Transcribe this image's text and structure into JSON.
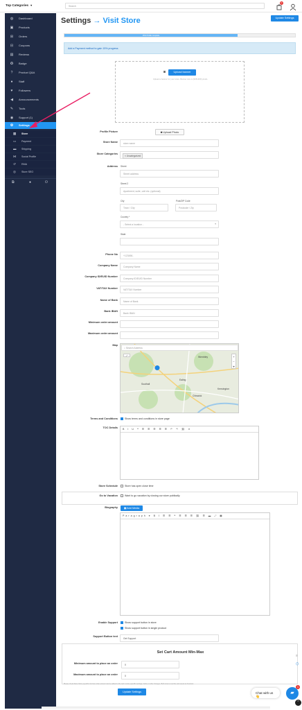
{
  "topbar": {
    "category_label": "Top Categories",
    "search_placeholder": "Search",
    "notification_count": "0"
  },
  "sidebar": {
    "items": [
      {
        "label": "Dashboard",
        "icon": "dashboard-icon"
      },
      {
        "label": "Products",
        "icon": "products-icon"
      },
      {
        "label": "Orders",
        "icon": "orders-icon"
      },
      {
        "label": "Coupons",
        "icon": "coupons-icon"
      },
      {
        "label": "Reviews",
        "icon": "reviews-icon"
      },
      {
        "label": "Badge",
        "icon": "badge-icon"
      },
      {
        "label": "Product Q&A",
        "icon": "question-icon"
      },
      {
        "label": "Staff",
        "icon": "staff-icon"
      },
      {
        "label": "Followers",
        "icon": "heart-icon"
      },
      {
        "label": "Announcements",
        "icon": "megaphone-icon"
      },
      {
        "label": "Tools",
        "icon": "wrench-icon"
      },
      {
        "label": "Support (1)",
        "icon": "support-icon"
      },
      {
        "label": "Settings",
        "icon": "gear-icon"
      }
    ],
    "sub_items": [
      {
        "label": "Store",
        "icon": "store-icon"
      },
      {
        "label": "Payment",
        "icon": "card-icon"
      },
      {
        "label": "Shipping",
        "icon": "truck-icon"
      },
      {
        "label": "Social Profile",
        "icon": "share-icon"
      },
      {
        "label": "RMA",
        "icon": "undo-icon"
      },
      {
        "label": "Store SEO",
        "icon": "globe-icon"
      }
    ]
  },
  "page": {
    "title": "Settings",
    "arrow": "→",
    "visit_store": "Visit Store",
    "update_settings": "Update Settings",
    "progress_text": "15% Profile complete",
    "progress_value": 0.75,
    "alert": "Add a Payment method to gain 15% progress",
    "upload_banner": "Upload banner",
    "banner_hint": "Upload a banner for your store. Banner size is (625x300) pixels."
  },
  "form": {
    "profile_picture": "Profile Picture",
    "upload_photo": "Upload Photo",
    "store_name": "Store Name",
    "store_name_ph": "store name",
    "store_categories": "Store Categories",
    "category_tag": "× Uncategorized",
    "address": "Address",
    "street": "Street",
    "street_ph": "Street address",
    "street2": "Street 2",
    "street2_ph": "Apartment, suite, unit etc. (optional)",
    "city": "City",
    "city_ph": "Town / City",
    "zip": "Post/ZIP Code",
    "zip_ph": "Postcode / Zip",
    "country": "Country *",
    "country_ph": "- Select a location -",
    "state": "State",
    "phone": "Phone No",
    "phone_ph": "+123456..",
    "company_name": "Company Name",
    "company_name_ph": "Company Name",
    "company_id": "Company ID/EUID Number",
    "company_id_ph": "Company ID/EUID Number",
    "vat": "VAT/TAX Number",
    "vat_ph": "VAT/TAX Number",
    "bank_name": "Name of Bank",
    "bank_name_ph": "Name of Bank",
    "iban": "Bank IBAN",
    "iban_ph": "Bank IBAN",
    "min_order": "Minimum order amount",
    "max_order": "Maximum order amount",
    "map": "Map",
    "map_search_ph": "Search Address",
    "map_labels": [
      "Wembley",
      "Ealing",
      "Southall",
      "Chiswick",
      "Kensington"
    ],
    "terms": "Terms and Conditions",
    "terms_check": "Show terms and conditions in store page",
    "toc": "TOC Details",
    "schedule": "Store Schedule",
    "schedule_check": "Store has open close time",
    "vacation": "Go to Vacation",
    "vacation_check": "Want to go vacation by closing our store publically",
    "biography": "Biography",
    "add_media": "Add Media",
    "paragraph": "Paragraph",
    "enable_support": "Enable Support",
    "support_check1": "Show support button in store",
    "support_check2": "Show support button in single product",
    "support_text": "Support Button text",
    "support_text_val": "Get Support",
    "cart_title": "Set Cart Amount Min-Max",
    "cart_min": "Minimum amount to place an order",
    "cart_min_val": "0",
    "cart_max": "Maximum amount to place an order",
    "cart_max_val": "0",
    "fine_print": "Please check that a Store-specific min/max order amount can be added to the cart in store-specific settings, before or after changes. Both store's override and saved at checkout.",
    "update_settings_bottom": "Update Settings",
    "chat": "Chat with us 👋",
    "chat_badge": "1"
  },
  "colors": {
    "accent": "#1e88e5",
    "sidebar": "#1f2a44",
    "active": "#2196f3"
  }
}
